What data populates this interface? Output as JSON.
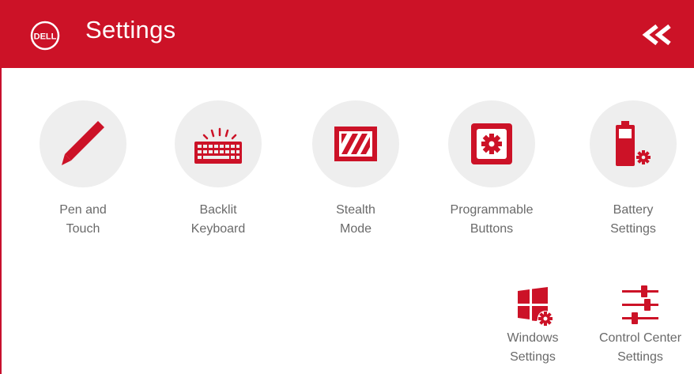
{
  "header": {
    "logo_text": "DELL",
    "title": "Settings",
    "collapse_icon": "double-chevron-left-icon"
  },
  "tiles": [
    {
      "label": "Pen and\nTouch",
      "icon": "pen-icon"
    },
    {
      "label": "Backlit\nKeyboard",
      "icon": "backlit-keyboard-icon"
    },
    {
      "label": "Stealth\nMode",
      "icon": "stealth-mode-icon"
    },
    {
      "label": "Programmable\nButtons",
      "icon": "programmable-button-icon"
    },
    {
      "label": "Battery\nSettings",
      "icon": "battery-settings-icon"
    }
  ],
  "links": [
    {
      "label": "Windows\nSettings",
      "icon": "windows-settings-icon"
    },
    {
      "label": "Control Center\nSettings",
      "icon": "control-center-sliders-icon"
    }
  ],
  "colors": {
    "accent": "#cc1227",
    "circle_bg": "#eeeeee",
    "label_text": "#6a6a6a"
  }
}
